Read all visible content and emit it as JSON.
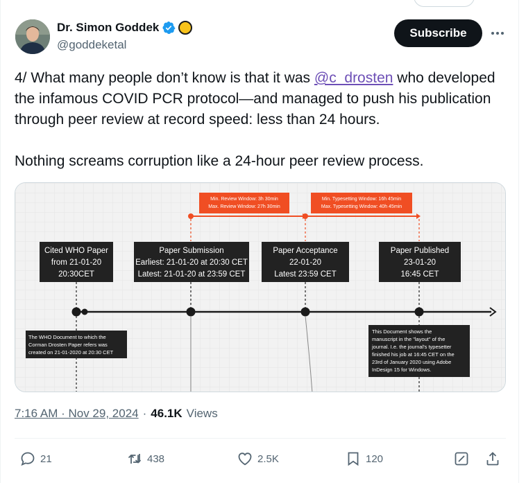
{
  "author": {
    "display_name": "Dr. Simon Goddek",
    "handle": "@goddeketal"
  },
  "header": {
    "subscribe_label": "Subscribe"
  },
  "tweet": {
    "text_before_mention": "4/ What many people don’t know is that it was ",
    "mention": "@c_drosten",
    "text_after_mention": " who developed the infamous COVID PCR protocol—and managed to push his publication through peer review at record speed: less than 24 hours.",
    "paragraph2": "Nothing screams corruption like a 24-hour peer review process."
  },
  "timeline": {
    "review_window": [
      "Min. Review Window: 3h 30min",
      "Max. Review Window: 27h 30min"
    ],
    "typesetting_window": [
      "Min. Typesetting Window: 16h 45min",
      "Max. Typesetting Window: 40h 45min"
    ],
    "boxes": [
      [
        "Cited WHO Paper",
        "from 21-01-20",
        "20:30CET"
      ],
      [
        "Paper Submission",
        "Earliest: 21-01-20 at 20:30 CET",
        "Latest: 21-01-20 at 23:59 CET"
      ],
      [
        "Paper Acceptance",
        "22-01-20",
        "Latest 23:59 CET"
      ],
      [
        "Paper Published",
        "23-01-20",
        "16:45 CET"
      ]
    ],
    "note_who": [
      "The WHO Document to which the",
      "Corman Drosten Paper refers was",
      "created on 21-01-2020 at 20:30 CET"
    ],
    "note_doc": [
      "This Document shows the",
      "manuscript in the \"layout\" of the",
      "journal. I.e. the journal's typesetter",
      "finished his job at 16:45 CET on the",
      "23rd of January 2020 using Adobe",
      "InDesign 15 for Windows."
    ]
  },
  "meta": {
    "timestamp": "7:16 AM · Nov 29, 2024",
    "separator": "·",
    "views_count": "46.1K",
    "views_label": "Views"
  },
  "actions": {
    "replies": "21",
    "reposts": "438",
    "likes": "2.5K",
    "bookmarks": "120"
  },
  "colors": {
    "accent_orange": "#f04e23",
    "mention_color": "#6d4fb6",
    "verified_blue": "#1d9bf0"
  }
}
